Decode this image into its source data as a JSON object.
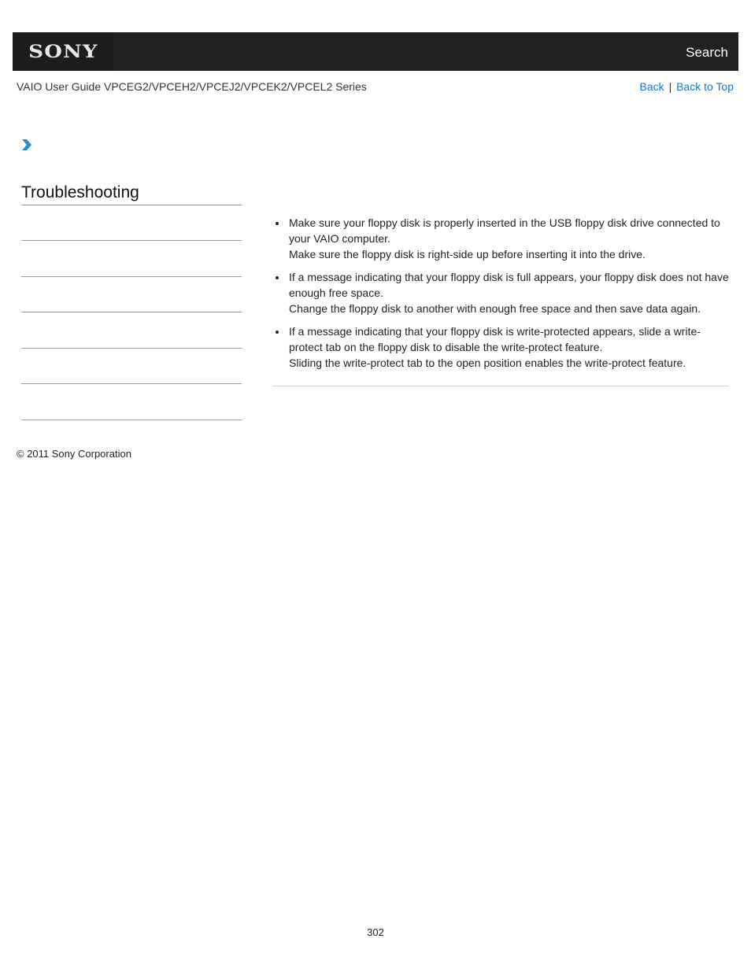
{
  "header": {
    "logo_text": "SONY",
    "search_label": "Search"
  },
  "subheader": {
    "guide_title": "VAIO User Guide VPCEG2/VPCEH2/VPCEJ2/VPCEK2/VPCEL2 Series",
    "back_label": "Back",
    "separator": "|",
    "back_to_top_label": "Back to Top"
  },
  "breadcrumb": {
    "icon": "chevron-right-icon",
    "color": "#2a8ad4"
  },
  "sidebar": {
    "title": "Troubleshooting",
    "items": [
      "",
      "",
      "",
      "",
      "",
      ""
    ]
  },
  "content": {
    "bullets": [
      {
        "main": "Make sure your floppy disk is properly inserted in the USB floppy disk drive connected to your VAIO computer.",
        "note": "Make sure the floppy disk is right-side up before inserting it into the drive."
      },
      {
        "main": "If a message indicating that your floppy disk is full appears, your floppy disk does not have enough free space.",
        "note": "Change the floppy disk to another with enough free space and then save data again."
      },
      {
        "main": "If a message indicating that your floppy disk is write-protected appears, slide a write-protect tab on the floppy disk to disable the write-protect feature.",
        "note": "Sliding the write-protect tab to the open position enables the write-protect feature."
      }
    ]
  },
  "footer": {
    "copyright": "© 2011 Sony Corporation",
    "page_number": "302"
  },
  "colors": {
    "header_bg": "#212121",
    "link": "#1a76c6",
    "accent": "#2a8ad4"
  }
}
